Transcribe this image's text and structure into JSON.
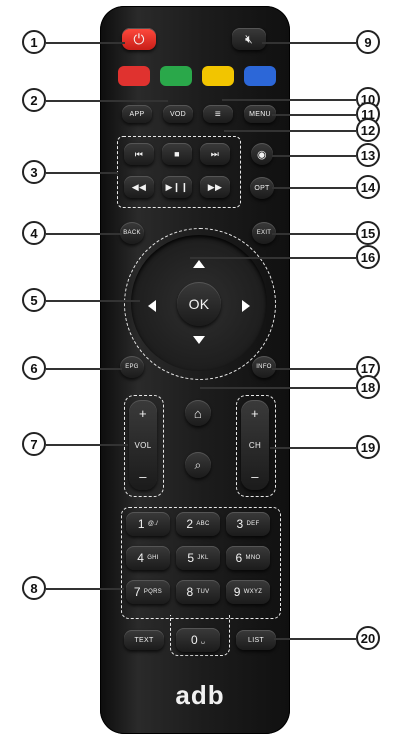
{
  "remote": {
    "power_icon": "power-icon",
    "mute_icon": "mute-icon",
    "color_keys": [
      {
        "name": "red",
        "color": "#e0322f"
      },
      {
        "name": "green",
        "color": "#2aa84a"
      },
      {
        "name": "yellow",
        "color": "#f2c500"
      },
      {
        "name": "blue",
        "color": "#2c67d8"
      }
    ],
    "labels": {
      "app": "APP",
      "vod": "VOD",
      "menu": "MENU",
      "opt": "OPT",
      "back": "BACK",
      "exit": "EXIT",
      "ok": "OK",
      "epg": "EPG",
      "info": "INFO",
      "vol": "VOL",
      "ch": "CH",
      "plus": "+",
      "minus": "–",
      "text": "TEXT",
      "list": "LIST",
      "brand": "adb"
    },
    "transport": [
      "⏮",
      "■",
      "⏭",
      "◀◀",
      "▶❙❙",
      "▶▶"
    ],
    "keypad": [
      {
        "digit": "1",
        "letters": "@./"
      },
      {
        "digit": "2",
        "letters": "ABC"
      },
      {
        "digit": "3",
        "letters": "DEF"
      },
      {
        "digit": "4",
        "letters": "GHI"
      },
      {
        "digit": "5",
        "letters": "JKL"
      },
      {
        "digit": "6",
        "letters": "MNO"
      },
      {
        "digit": "7",
        "letters": "PQRS"
      },
      {
        "digit": "8",
        "letters": "TUV"
      },
      {
        "digit": "9",
        "letters": "WXYZ"
      },
      {
        "digit": "0",
        "letters": "␣"
      }
    ]
  },
  "callouts": [
    "1",
    "2",
    "3",
    "4",
    "5",
    "6",
    "7",
    "8",
    "9",
    "10",
    "11",
    "12",
    "13",
    "14",
    "15",
    "16",
    "17",
    "18",
    "19",
    "20"
  ]
}
